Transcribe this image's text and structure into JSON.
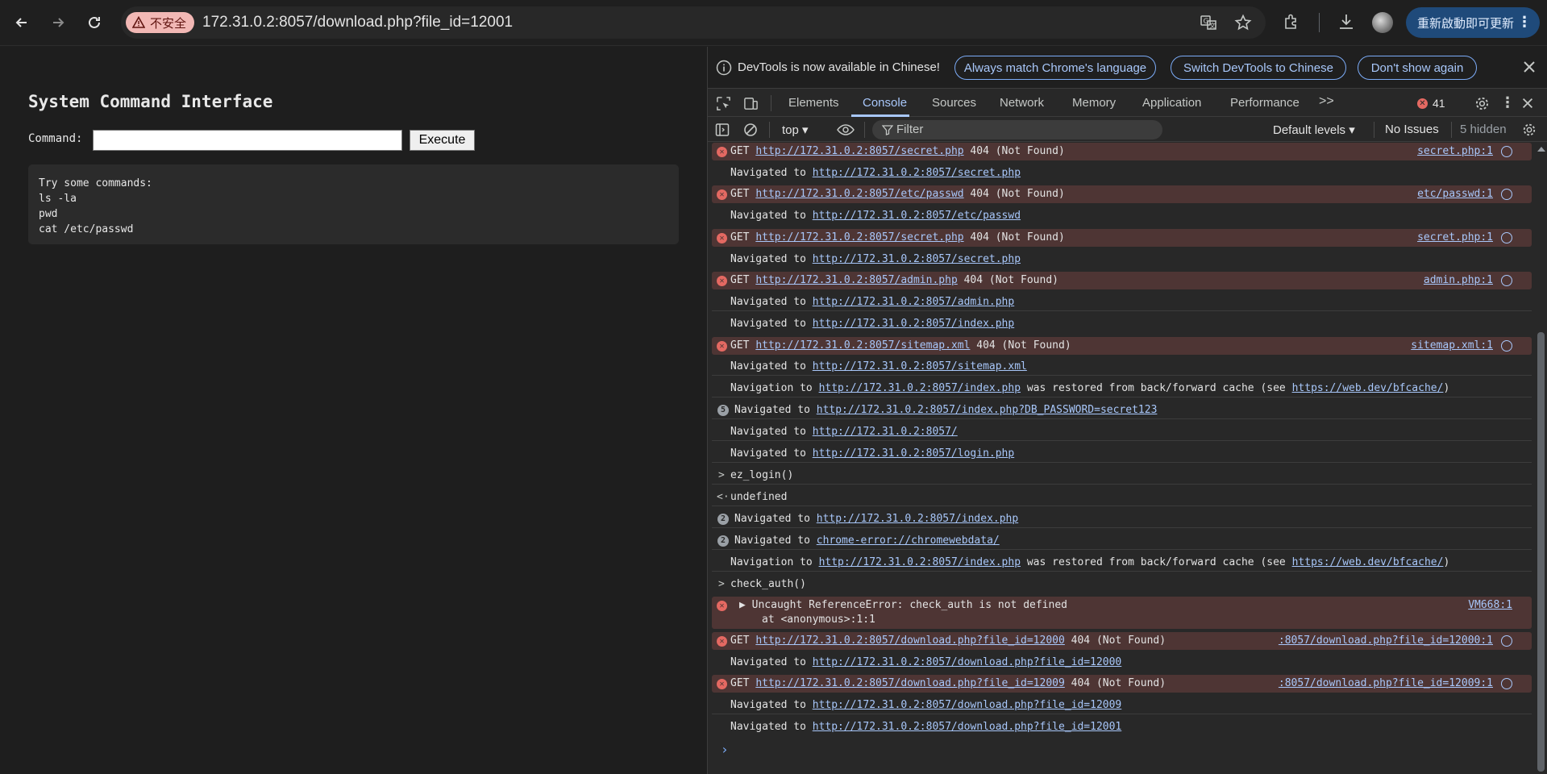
{
  "browser": {
    "insecure_label": "不安全",
    "url": "172.31.0.2:8057/download.php?file_id=12001",
    "update_button": "重新啟動即可更新"
  },
  "page": {
    "title": "System Command Interface",
    "command_label": "Command:",
    "command_value": "",
    "execute_label": "Execute",
    "output": "Try some commands:\nls -la\npwd\ncat /etc/passwd"
  },
  "devtools": {
    "infobar": {
      "text": "DevTools is now available in Chinese!",
      "btn_match": "Always match Chrome's language",
      "btn_switch": "Switch DevTools to Chinese",
      "btn_dont_show": "Don't show again"
    },
    "tabs": [
      "Elements",
      "Console",
      "Sources",
      "Network",
      "Memory",
      "Application",
      "Performance"
    ],
    "more_tabs": ">>",
    "error_count": "41",
    "filterbar": {
      "context": "top",
      "filter_placeholder": "Filter",
      "levels": "Default levels",
      "issues": "No Issues",
      "hidden": "5 hidden"
    },
    "console": {
      "r0": {
        "method": "GET",
        "url": "http://172.31.0.2:8057/secret.php",
        "status": "404 (Not Found)",
        "source": "secret.php:1"
      },
      "r1": {
        "prefix": "Navigated to",
        "url": "http://172.31.0.2:8057/secret.php"
      },
      "r2": {
        "method": "GET",
        "url": "http://172.31.0.2:8057/etc/passwd",
        "status": "404 (Not Found)",
        "source": "etc/passwd:1"
      },
      "r3": {
        "prefix": "Navigated to",
        "url": "http://172.31.0.2:8057/etc/passwd"
      },
      "r4": {
        "method": "GET",
        "url": "http://172.31.0.2:8057/secret.php",
        "status": "404 (Not Found)",
        "source": "secret.php:1"
      },
      "r5": {
        "prefix": "Navigated to",
        "url": "http://172.31.0.2:8057/secret.php"
      },
      "r6": {
        "method": "GET",
        "url": "http://172.31.0.2:8057/admin.php",
        "status": "404 (Not Found)",
        "source": "admin.php:1"
      },
      "r7": {
        "prefix": "Navigated to",
        "url": "http://172.31.0.2:8057/admin.php"
      },
      "r8": {
        "prefix": "Navigated to",
        "url": "http://172.31.0.2:8057/index.php"
      },
      "r9": {
        "method": "GET",
        "url": "http://172.31.0.2:8057/sitemap.xml",
        "status": "404 (Not Found)",
        "source": "sitemap.xml:1"
      },
      "r10": {
        "prefix": "Navigated to",
        "url": "http://172.31.0.2:8057/sitemap.xml"
      },
      "r11": {
        "prefix": "Navigation to",
        "url": "http://172.31.0.2:8057/index.php",
        "mid": "was restored from back/forward cache (see",
        "url2": "https://web.dev/bfcache/",
        "suffix": ")"
      },
      "r12": {
        "count": "5",
        "prefix": "Navigated to",
        "url": "http://172.31.0.2:8057/index.php?DB_PASSWORD=secret123"
      },
      "r13": {
        "prefix": "Navigated to",
        "url": "http://172.31.0.2:8057/"
      },
      "r14": {
        "prefix": "Navigated to",
        "url": "http://172.31.0.2:8057/login.php"
      },
      "r15": {
        "glyph": ">",
        "text": "ez_login()"
      },
      "r16": {
        "glyph": "<·",
        "text": "undefined"
      },
      "r17": {
        "count": "2",
        "prefix": "Navigated to",
        "url": "http://172.31.0.2:8057/index.php"
      },
      "r18": {
        "count": "2",
        "prefix": "Navigated to",
        "url": "chrome-error://chromewebdata/"
      },
      "r19": {
        "prefix": "Navigation to",
        "url": "http://172.31.0.2:8057/index.php",
        "mid": "was restored from back/forward cache (see",
        "url2": "https://web.dev/bfcache/",
        "suffix": ")"
      },
      "r20": {
        "glyph": ">",
        "text": "check_auth()"
      },
      "r21": {
        "line1": "▶ Uncaught ReferenceError: check_auth is not defined",
        "line2": "at <anonymous>:1:1",
        "source": "VM668:1"
      },
      "r22": {
        "method": "GET",
        "url": "http://172.31.0.2:8057/download.php?file_id=12000",
        "status": "404 (Not Found)",
        "source": ":8057/download.php?file_id=12000:1"
      },
      "r23": {
        "prefix": "Navigated to",
        "url": "http://172.31.0.2:8057/download.php?file_id=12000"
      },
      "r24": {
        "method": "GET",
        "url": "http://172.31.0.2:8057/download.php?file_id=12009",
        "status": "404 (Not Found)",
        "source": ":8057/download.php?file_id=12009:1"
      },
      "r25": {
        "prefix": "Navigated to",
        "url": "http://172.31.0.2:8057/download.php?file_id=12009"
      },
      "r26": {
        "prefix": "Navigated to",
        "url": "http://172.31.0.2:8057/download.php?file_id=12001"
      }
    }
  }
}
